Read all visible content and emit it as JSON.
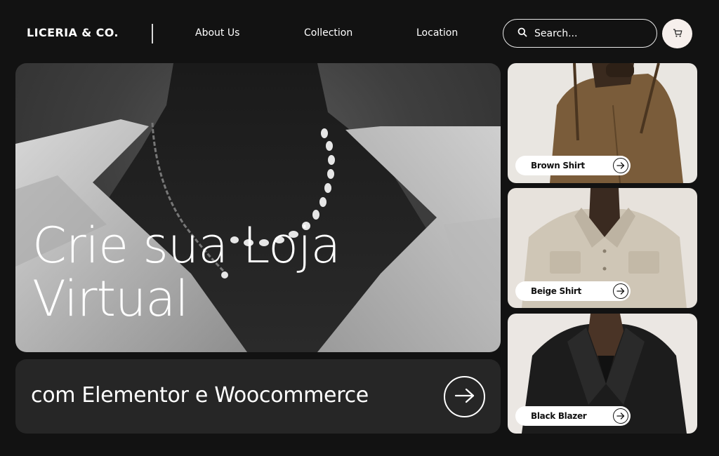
{
  "header": {
    "logo": "LICERIA & CO.",
    "nav": [
      "About Us",
      "Collection",
      "Location"
    ],
    "search_placeholder": "Search...",
    "cart_icon": "cart-icon"
  },
  "hero": {
    "title_line1": "Crie sua Loja",
    "title_line2": "Virtual",
    "subtitle": "com Elementor e Woocommerce"
  },
  "products": [
    {
      "label": "Brown Shirt",
      "color": "#7a5c3a"
    },
    {
      "label": "Beige Shirt",
      "color": "#cfc6b6"
    },
    {
      "label": "Black Blazer",
      "color": "#1c1c1c"
    }
  ],
  "colors": {
    "background": "#121212",
    "panel": "#262626",
    "cart_bg": "#f6efec"
  }
}
